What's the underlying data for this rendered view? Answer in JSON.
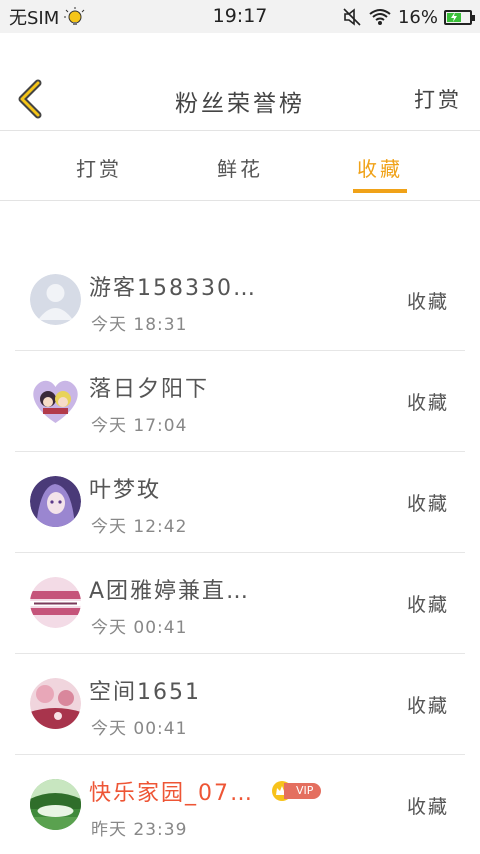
{
  "status_bar": {
    "carrier": "无SIM",
    "time": "19:17",
    "battery": "16%",
    "battery_level": 0.16,
    "icons": [
      "lightbulb-icon",
      "mute-icon",
      "wifi-icon",
      "battery-icon"
    ]
  },
  "header": {
    "back_icon": "chevron-left-icon",
    "title": "粉丝荣誉榜",
    "right_link": "打赏"
  },
  "tabs": [
    {
      "label": "打赏",
      "active": false
    },
    {
      "label": "鲜花",
      "active": false
    },
    {
      "label": "收藏",
      "active": true
    }
  ],
  "colors": {
    "accent": "#f0a218",
    "vip_name": "#ee5535",
    "text": "#555555",
    "divider": "#e6e6e6"
  },
  "list": [
    {
      "name": "游客158330…",
      "time": "今天 18:31",
      "action": "收藏",
      "vip": false,
      "avatar": "default-user-avatar"
    },
    {
      "name": "落日夕阳下",
      "time": "今天 17:04",
      "action": "收藏",
      "vip": false,
      "avatar": "anime-couple-avatar"
    },
    {
      "name": "叶梦玫",
      "time": "今天 12:42",
      "action": "收藏",
      "vip": false,
      "avatar": "purple-anime-avatar"
    },
    {
      "name": "A团雅婷兼直…",
      "time": "今天 00:41",
      "action": "收藏",
      "vip": false,
      "avatar": "pink-banner-avatar"
    },
    {
      "name": "空间1651",
      "time": "今天 00:41",
      "action": "收藏",
      "vip": false,
      "avatar": "pink-flower-avatar"
    },
    {
      "name": "快乐家园_07…",
      "time": "昨天 23:39",
      "action": "收藏",
      "vip": true,
      "vip_label": "VIP",
      "avatar": "green-landscape-avatar"
    }
  ]
}
